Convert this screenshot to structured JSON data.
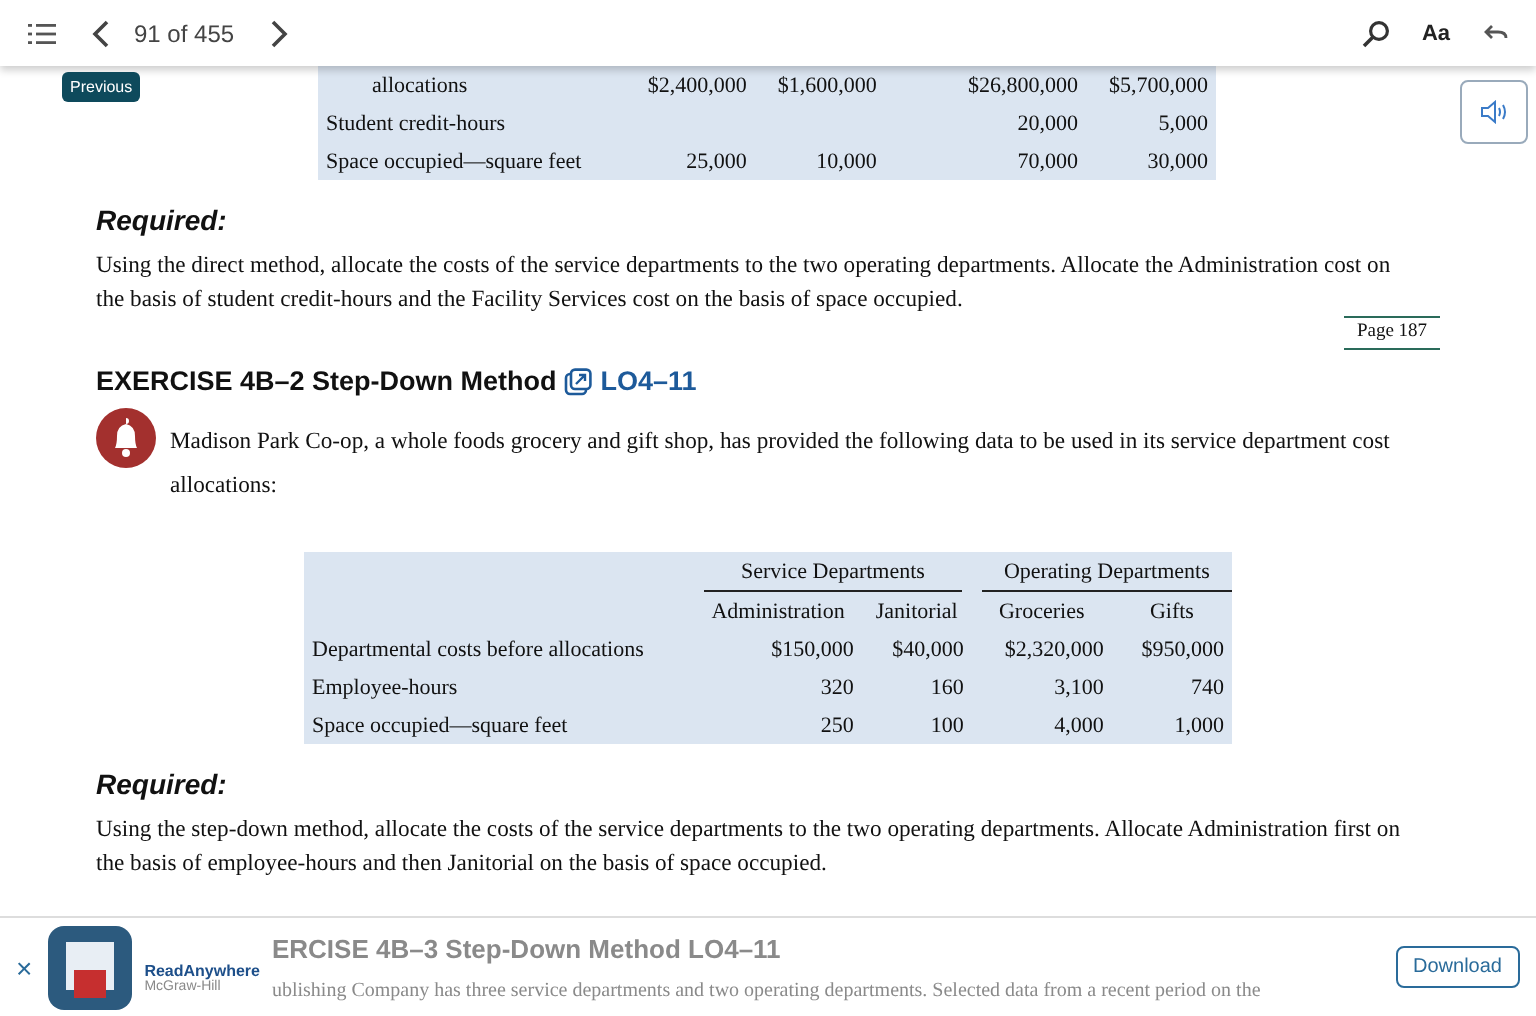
{
  "toolbar": {
    "page_indicator": "91 of 455",
    "font_button": "Aa",
    "tooltip": "Previous"
  },
  "top_table": {
    "rows": [
      {
        "label": "allocations",
        "indented": true,
        "cells": [
          "$2,400,000",
          "$1,600,000",
          "$26,800,000",
          "$5,700,000"
        ]
      },
      {
        "label": "Student credit-hours",
        "indented": false,
        "cells": [
          null,
          null,
          "20,000",
          "5,000"
        ]
      },
      {
        "label": "Space occupied—square feet",
        "indented": false,
        "cells": [
          "25,000",
          "10,000",
          "70,000",
          "30,000"
        ]
      }
    ]
  },
  "required_1": {
    "heading": "Required:",
    "text": "Using the direct method, allocate the costs of the service departments to the two operating departments. Allocate the Administration cost on the basis of student credit-hours and the Facility Services cost on the basis of space occupied.",
    "page_marker": "Page 187"
  },
  "exercise": {
    "title": "EXERCISE 4B–2 Step-Down Method",
    "link": "LO4–11",
    "intro": "Madison Park Co-op, a whole foods grocery and gift shop, has provided the following data to be used in its service department cost allocations:"
  },
  "data_table": {
    "groups": [
      "Service Departments",
      "Operating Departments"
    ],
    "columns": [
      "Administration",
      "Janitorial",
      "Groceries",
      "Gifts"
    ],
    "rows": [
      {
        "label": "Departmental costs before allocations",
        "values": [
          "$150,000",
          "$40,000",
          "$2,320,000",
          "$950,000"
        ]
      },
      {
        "label": "Employee-hours",
        "values": [
          "320",
          "160",
          "3,100",
          "740"
        ]
      },
      {
        "label": "Space occupied—square feet",
        "values": [
          "250",
          "100",
          "4,000",
          "1,000"
        ]
      }
    ]
  },
  "required_2": {
    "heading": "Required:",
    "text": "Using the step-down method, allocate the costs of the service departments to the two operating departments. Allocate Administration first on the basis of employee-hours and then Janitorial on the basis of space occupied."
  },
  "banner": {
    "close": "×",
    "app_name": "ReadAnywhere",
    "publisher": "McGraw-Hill",
    "button": "Download",
    "faded_heading": "ERCISE 4B–3 Step-Down Method",
    "faded_link": "LO4–11",
    "faded_text": "ublishing Company has three service departments and two operating departments. Selected data from a recent period on the"
  }
}
